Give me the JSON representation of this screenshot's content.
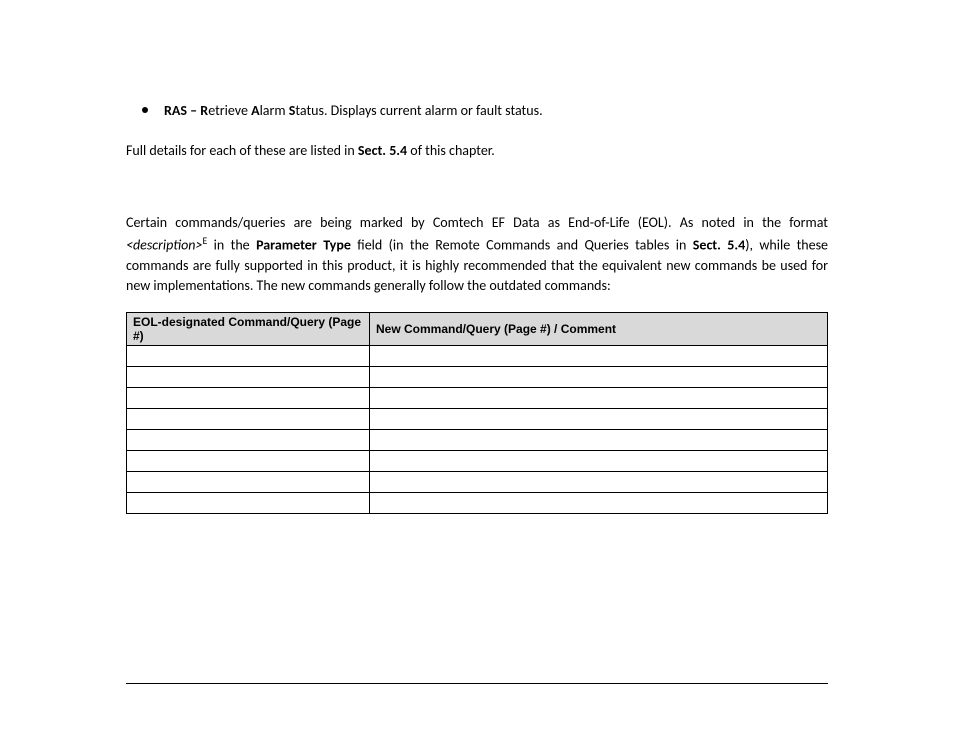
{
  "bullet": {
    "lead_bold": "RAS – ",
    "R": "R",
    "retrieve_tail": "etrieve ",
    "A": "A",
    "alarm_tail": "larm ",
    "S": "S",
    "status_tail": "tatus. Displays current alarm or fault status."
  },
  "para_details": {
    "pre": "Full details for each of these are listed in ",
    "sect": "Sect. 5.4",
    "post": " of this chapter."
  },
  "para_eol": {
    "p1": "Certain commands/queries are being marked by Comtech EF Data as End-of-Life (EOL). As noted in the format ",
    "desc": "<description>",
    "sup": "E",
    "p2": " in the ",
    "bold1": "Parameter Type",
    "p3": " field (in the Remote Commands and Queries tables in ",
    "bold2": "Sect. 5.4",
    "p4": "), while these commands are fully supported in this product, it is highly recommended that the equivalent new commands be used for new implementations. The new commands generally follow the outdated commands:"
  },
  "table": {
    "h1": "EOL-designated Command/Query (Page #)",
    "h2": "New Command/Query (Page #) / Comment",
    "rows": [
      {
        "c1": "",
        "c2": ""
      },
      {
        "c1": "",
        "c2": ""
      },
      {
        "c1": "",
        "c2": ""
      },
      {
        "c1": "",
        "c2": ""
      },
      {
        "c1": "",
        "c2": ""
      },
      {
        "c1": "",
        "c2": ""
      },
      {
        "c1": "",
        "c2": ""
      },
      {
        "c1": "",
        "c2": ""
      }
    ]
  }
}
